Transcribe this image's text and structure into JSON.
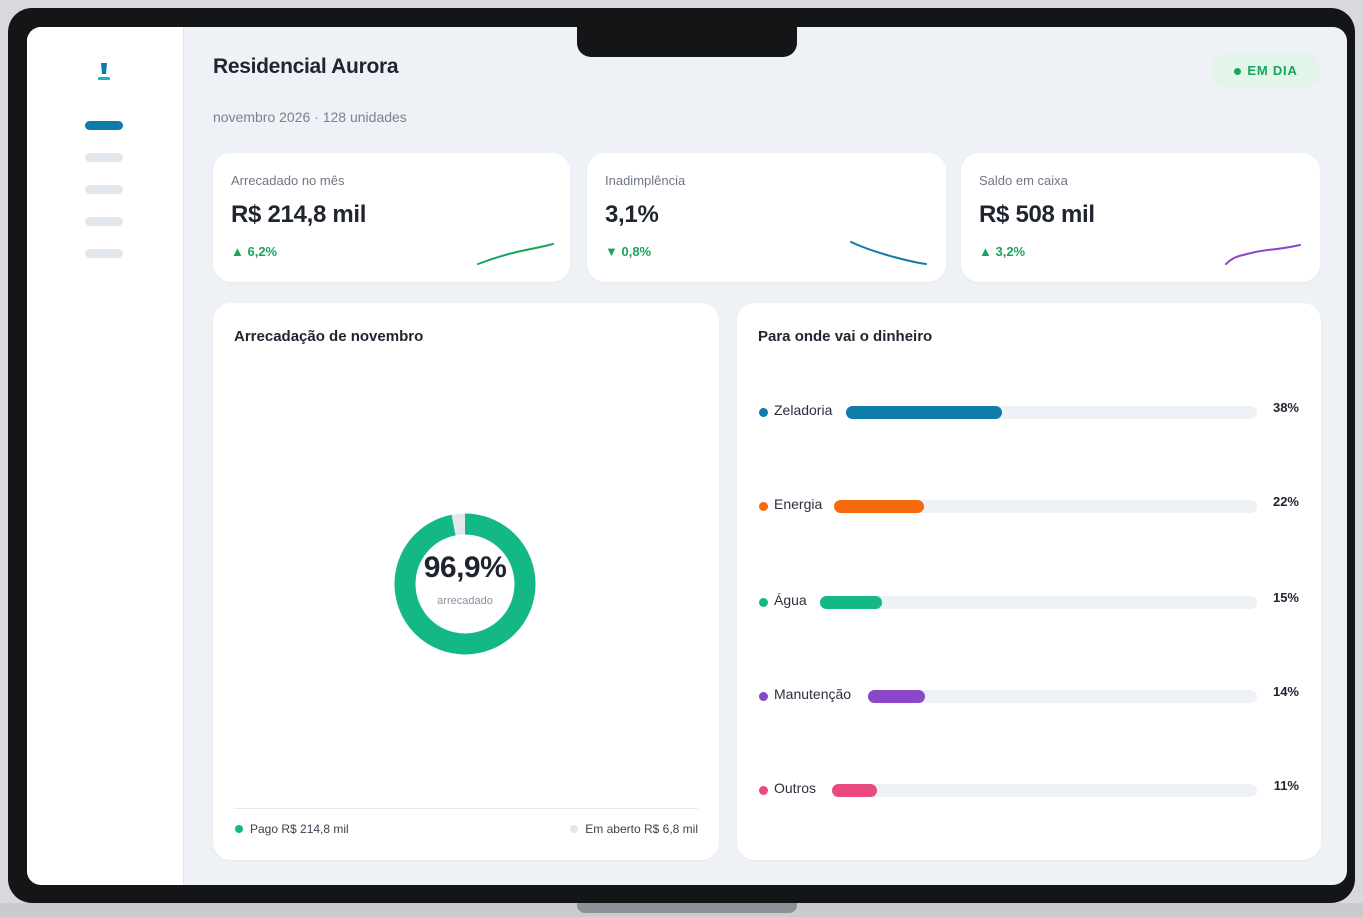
{
  "header": {
    "title": "Residencial Aurora",
    "subtitle": "novembro 2026 · 128 unidades",
    "status": "EM DIA"
  },
  "sidebar": {
    "logo_icon": "brush-icon",
    "items": [
      {
        "name": "nav-item-1",
        "active": true
      },
      {
        "name": "nav-item-2",
        "active": false
      },
      {
        "name": "nav-item-3",
        "active": false
      },
      {
        "name": "nav-item-4",
        "active": false
      },
      {
        "name": "nav-item-5",
        "active": false
      }
    ]
  },
  "kpis": [
    {
      "label": "Arrecadado no mês",
      "value": "R$ 214,8 mil",
      "delta": "▲ 6,2%",
      "spark_color": "#17a55e"
    },
    {
      "label": "Inadimplência",
      "value": "3,1%",
      "delta": "▼ 0,8%",
      "spark_color": "#0f7ba8"
    },
    {
      "label": "Saldo em caixa",
      "value": "R$ 508 mil",
      "delta": "▲ 3,2%",
      "spark_color": "#8b47c8"
    }
  ],
  "collection": {
    "title": "Arrecadação de novembro",
    "percent_value": 96.9,
    "percent_label": "96,9%",
    "caption": "arrecadado",
    "paid_label": "Pago R$ 214,8 mil",
    "open_label": "Em aberto R$ 6,8 mil",
    "paid_color": "#14b886",
    "open_color": "#e3e7ee"
  },
  "expenses": {
    "title": "Para onde vai o dinheiro",
    "items": [
      {
        "label": "Zeladoria",
        "percent": 38,
        "percent_label": "38%",
        "color": "#0f7ba8"
      },
      {
        "label": "Energia",
        "percent": 22,
        "percent_label": "22%",
        "color": "#f56a0f"
      },
      {
        "label": "Água",
        "percent": 15,
        "percent_label": "15%",
        "color": "#14b886"
      },
      {
        "label": "Manutenção",
        "percent": 14,
        "percent_label": "14%",
        "color": "#8b47c8"
      },
      {
        "label": "Outros",
        "percent": 11,
        "percent_label": "11%",
        "color": "#e84a7f"
      }
    ]
  }
}
